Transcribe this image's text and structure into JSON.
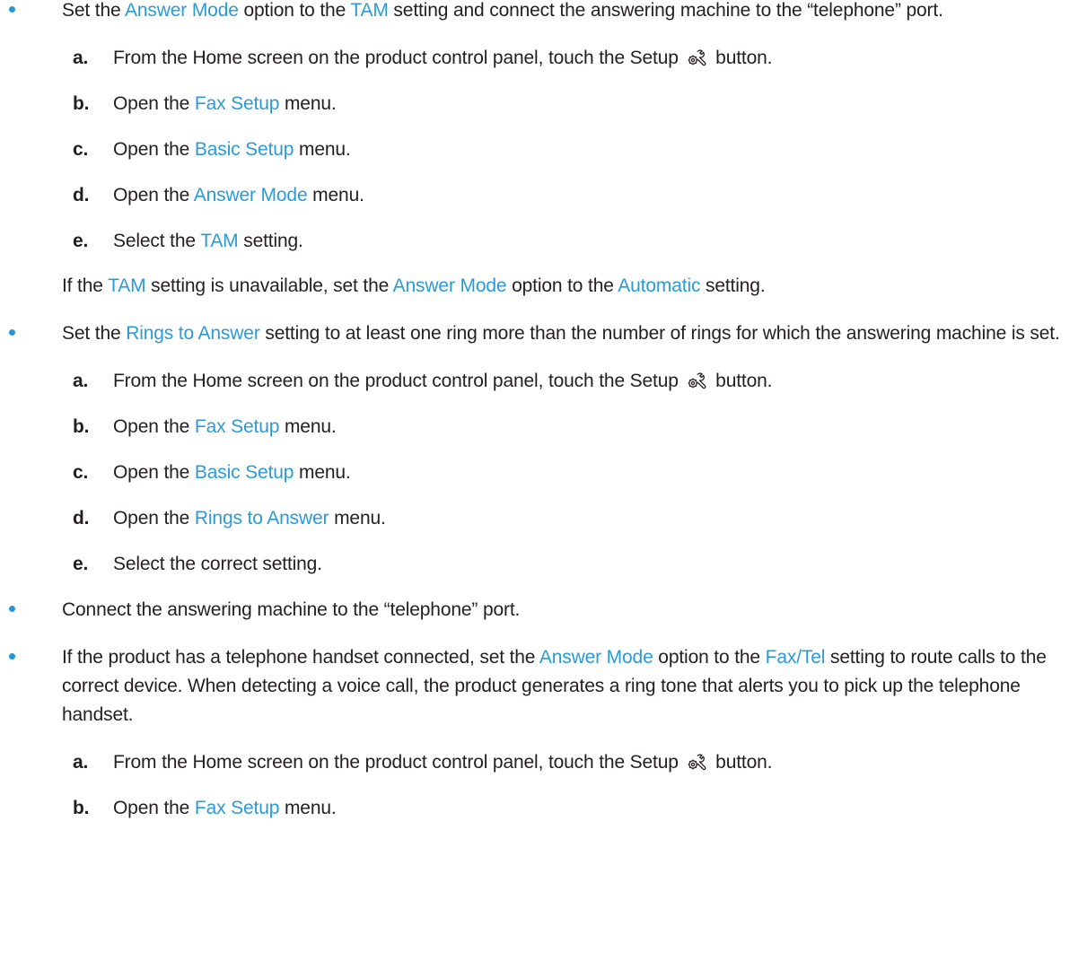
{
  "bullets": [
    {
      "segments": [
        {
          "text": "Set the "
        },
        {
          "text": "Answer Mode",
          "link": true
        },
        {
          "text": " option to the "
        },
        {
          "text": "TAM",
          "link": true
        },
        {
          "text": " setting and connect the answering machine to the “telephone” port."
        }
      ],
      "steps": [
        {
          "letter": "a.",
          "before": "From the Home screen on the product control panel, touch the Setup ",
          "icon": "setup-wrench-gear-icon",
          "after": " button."
        },
        {
          "letter": "b.",
          "before": "Open the ",
          "link": "Fax Setup",
          "after": " menu."
        },
        {
          "letter": "c.",
          "before": "Open the ",
          "link": "Basic Setup",
          "after": " menu."
        },
        {
          "letter": "d.",
          "before": "Open the ",
          "link": "Answer Mode",
          "after": " menu."
        },
        {
          "letter": "e.",
          "before": "Select the ",
          "link": "TAM",
          "after": " setting."
        }
      ],
      "note": [
        {
          "text": "If the "
        },
        {
          "text": "TAM",
          "link": true
        },
        {
          "text": " setting is unavailable, set the "
        },
        {
          "text": "Answer Mode",
          "link": true
        },
        {
          "text": " option to the "
        },
        {
          "text": "Automatic",
          "link": true
        },
        {
          "text": " setting."
        }
      ]
    },
    {
      "segments": [
        {
          "text": "Set the "
        },
        {
          "text": "Rings to Answer",
          "link": true
        },
        {
          "text": " setting to at least one ring more than the number of rings for which the answering machine is set."
        }
      ],
      "steps": [
        {
          "letter": "a.",
          "before": "From the Home screen on the product control panel, touch the Setup ",
          "icon": "setup-wrench-gear-icon",
          "after": " button."
        },
        {
          "letter": "b.",
          "before": "Open the ",
          "link": "Fax Setup",
          "after": " menu."
        },
        {
          "letter": "c.",
          "before": "Open the ",
          "link": "Basic Setup",
          "after": " menu."
        },
        {
          "letter": "d.",
          "before": "Open the ",
          "link": "Rings to Answer",
          "after": " menu."
        },
        {
          "letter": "e.",
          "before": "Select the correct setting.",
          "link": "",
          "after": ""
        }
      ]
    },
    {
      "segments": [
        {
          "text": "Connect the answering machine to the “telephone” port."
        }
      ]
    },
    {
      "segments": [
        {
          "text": "If the product has a telephone handset connected, set the "
        },
        {
          "text": "Answer Mode",
          "link": true
        },
        {
          "text": " option to the "
        },
        {
          "text": "Fax/Tel",
          "link": true
        },
        {
          "text": " setting to route calls to the correct device. When detecting a voice call, the product generates a ring tone that alerts you to pick up the telephone handset."
        }
      ],
      "steps": [
        {
          "letter": "a.",
          "before": "From the Home screen on the product control panel, touch the Setup ",
          "icon": "setup-wrench-gear-icon",
          "after": " button."
        },
        {
          "letter": "b.",
          "before": "Open the ",
          "link": "Fax Setup",
          "after": " menu."
        }
      ]
    }
  ],
  "colors": {
    "text": "#231f20",
    "link": "#2a9bd8",
    "bullet": "#2597d8"
  }
}
